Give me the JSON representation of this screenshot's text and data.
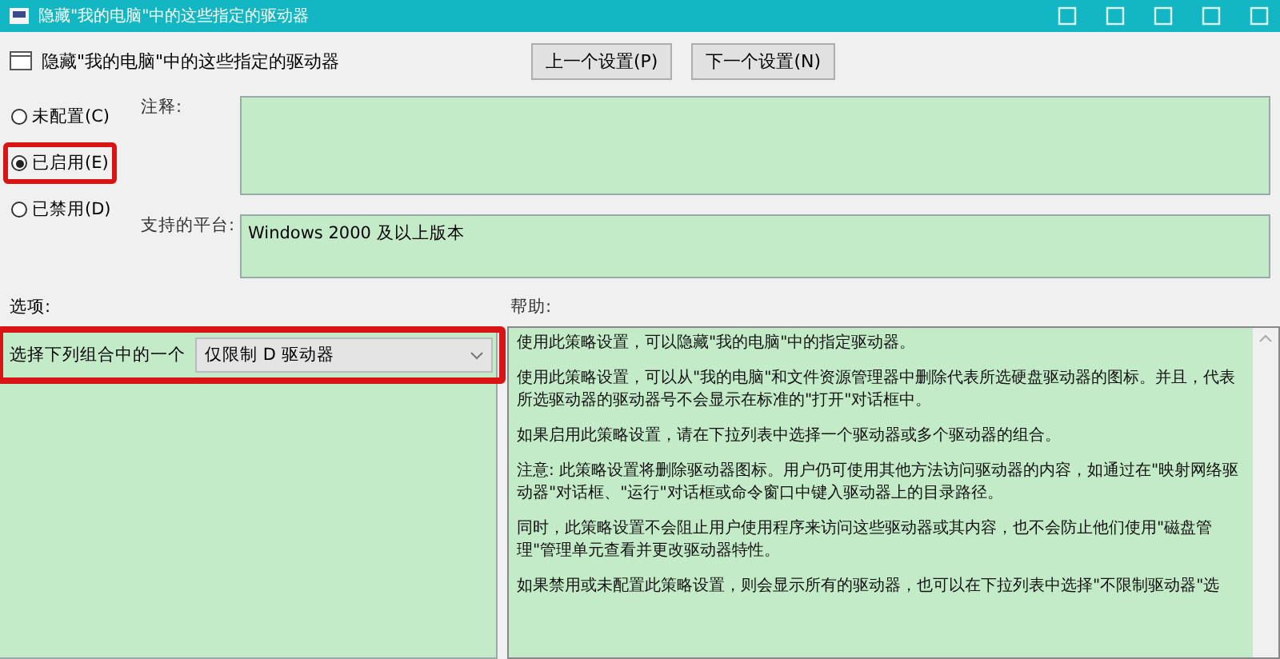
{
  "window": {
    "title": "隐藏\"我的电脑\"中的这些指定的驱动器"
  },
  "header": {
    "policy_name": "隐藏\"我的电脑\"中的这些指定的驱动器",
    "buttons": [
      "上一个设置(P)",
      "下一个设置(N)"
    ]
  },
  "state_options": [
    {
      "label": "未配置(C)",
      "selected": false,
      "highlighted": false
    },
    {
      "label": "已启用(E)",
      "selected": true,
      "highlighted": true
    },
    {
      "label": "已禁用(D)",
      "selected": false,
      "highlighted": false
    }
  ],
  "comment": {
    "label": "注释:"
  },
  "platform": {
    "label": "支持的平台:",
    "value": "Windows 2000 及以上版本"
  },
  "options": {
    "label": "选项:",
    "combo_label": "选择下列组合中的一个",
    "combo_value": "仅限制 D 驱动器",
    "highlighted": true
  },
  "help": {
    "label": "帮助:",
    "paragraphs": [
      "使用此策略设置，可以隐藏\"我的电脑\"中的指定驱动器。",
      "使用此策略设置，可以从\"我的电脑\"和文件资源管理器中删除代表所选硬盘驱动器的图标。并且，代表所选驱动器的驱动器号不会显示在标准的\"打开\"对话框中。",
      "如果启用此策略设置，请在下拉列表中选择一个驱动器或多个驱动器的组合。",
      "注意: 此策略设置将删除驱动器图标。用户仍可使用其他方法访问驱动器的内容，如通过在\"映射网络驱动器\"对话框、\"运行\"对话框或命令窗口中键入驱动器上的目录路径。",
      "同时，此策略设置不会阻止用户使用程序来访问这些驱动器或其内容，也不会防止他们使用\"磁盘管理\"管理单元查看并更改驱动器特性。",
      "如果禁用或未配置此策略设置，则会显示所有的驱动器，也可以在下拉列表中选择\"不限制驱动器\"选"
    ]
  }
}
